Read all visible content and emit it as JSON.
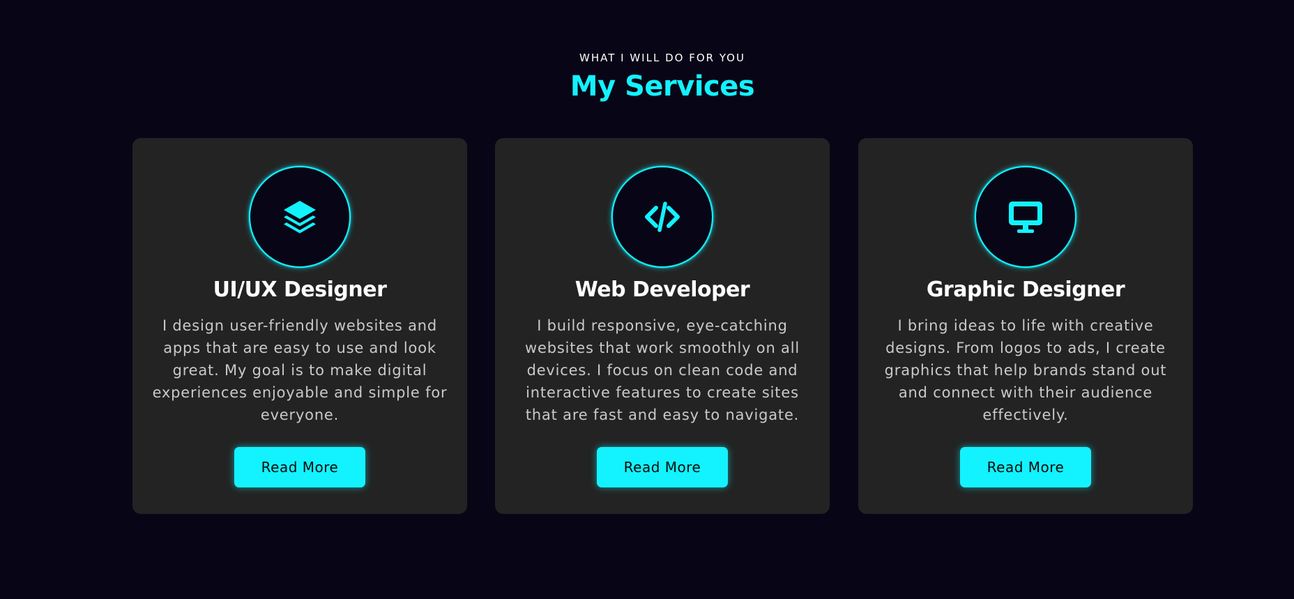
{
  "header": {
    "subtitle": "WHAT I WILL DO FOR YOU",
    "title": "My Services"
  },
  "colors": {
    "background": "#080616",
    "card": "#232323",
    "accent": "#13f2ff",
    "text": "#ffffff",
    "muted_text": "#c9c9c9"
  },
  "services": [
    {
      "icon": "layers-icon",
      "title": "UI/UX Designer",
      "description": "I design user-friendly websites and apps that are easy to use and look great. My goal is to make digital experiences enjoyable and simple for everyone.",
      "button_label": "Read More"
    },
    {
      "icon": "code-icon",
      "title": "Web Developer",
      "description": "I build responsive, eye-catching websites that work smoothly on all devices. I focus on clean code and interactive features to create sites that are fast and easy to navigate.",
      "button_label": "Read More"
    },
    {
      "icon": "desktop-icon",
      "title": "Graphic Designer",
      "description": "I bring ideas to life with creative designs. From logos to ads, I create graphics that help brands stand out and connect with their audience effectively.",
      "button_label": "Read More"
    }
  ]
}
